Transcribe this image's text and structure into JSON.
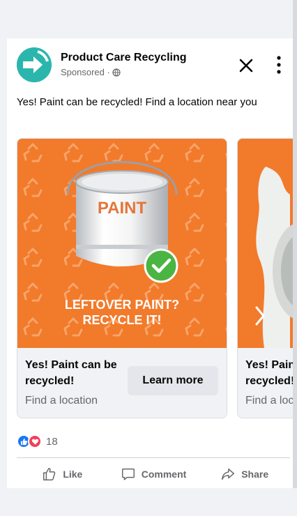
{
  "post": {
    "page_name": "Product Care Recycling",
    "sponsored": "Sponsored ·",
    "text": "Yes! Paint can be recycled! Find a location near you"
  },
  "carousel": {
    "cards": [
      {
        "image_can_label": "PAINT",
        "image_caption_line1": "LEFTOVER PAINT?",
        "image_caption_line2": "RECYCLE IT!",
        "headline": "Yes! Paint can be recycled!",
        "subtitle": "Find a location",
        "cta": "Learn more"
      },
      {
        "headline": "Yes! Paint can be recycled!",
        "subtitle": "Find a location"
      }
    ]
  },
  "reactions": {
    "count": "18"
  },
  "actions": {
    "like": "Like",
    "comment": "Comment",
    "share": "Share"
  },
  "colors": {
    "brand_teal": "#2bb6ad",
    "card_orange": "#f27a2b",
    "check_green": "#4bb543",
    "like_blue": "#1877f2",
    "love_red": "#f33e58"
  },
  "icons": [
    "globe-icon",
    "close-icon",
    "more-icon",
    "like-reaction-icon",
    "love-reaction-icon",
    "like-icon",
    "comment-icon",
    "share-icon",
    "check-icon",
    "recycle-icon",
    "chevron-right-icon"
  ]
}
